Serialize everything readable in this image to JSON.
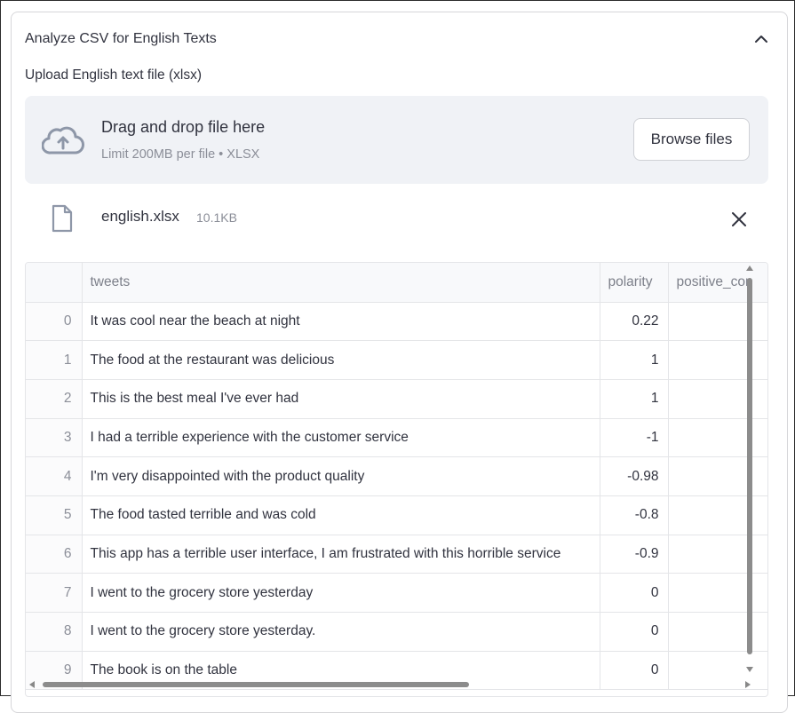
{
  "expander": {
    "title": "Analyze CSV for English Texts",
    "chevron_icon": "chevron-up-icon"
  },
  "uploader": {
    "label": "Upload English text file (xlsx)",
    "drop_text": "Drag and drop file here",
    "limit_text": "Limit 200MB per file • XLSX",
    "browse_label": "Browse files",
    "cloud_icon": "cloud-upload-icon"
  },
  "file": {
    "name": "english.xlsx",
    "size": "10.1KB",
    "file_icon": "file-icon",
    "close_icon": "close-icon"
  },
  "table": {
    "columns": [
      "",
      "tweets",
      "polarity",
      "positive_cor"
    ],
    "rows": [
      {
        "index": "0",
        "tweets": "It was cool near the beach at night",
        "polarity": "0.22"
      },
      {
        "index": "1",
        "tweets": "The food at the restaurant was delicious",
        "polarity": "1"
      },
      {
        "index": "2",
        "tweets": "This is the best meal I've ever had",
        "polarity": "1"
      },
      {
        "index": "3",
        "tweets": "I had a terrible experience with the customer service",
        "polarity": "-1"
      },
      {
        "index": "4",
        "tweets": "I'm very disappointed with the product quality",
        "polarity": "-0.98"
      },
      {
        "index": "5",
        "tweets": "The food tasted terrible and was cold",
        "polarity": "-0.8"
      },
      {
        "index": "6",
        "tweets": "This app has a terrible user interface, I am frustrated with this horrible service",
        "polarity": "-0.9"
      },
      {
        "index": "7",
        "tweets": "I went to the grocery store yesterday",
        "polarity": "0"
      },
      {
        "index": "8",
        "tweets": "I went to the grocery store yesterday.",
        "polarity": "0"
      },
      {
        "index": "9",
        "tweets": "The book is on the table",
        "polarity": "0"
      }
    ]
  },
  "colors": {
    "text": "#31333f",
    "muted": "#8b8e98",
    "dropzone_bg": "#f0f2f6",
    "border": "#e4e5e8"
  }
}
